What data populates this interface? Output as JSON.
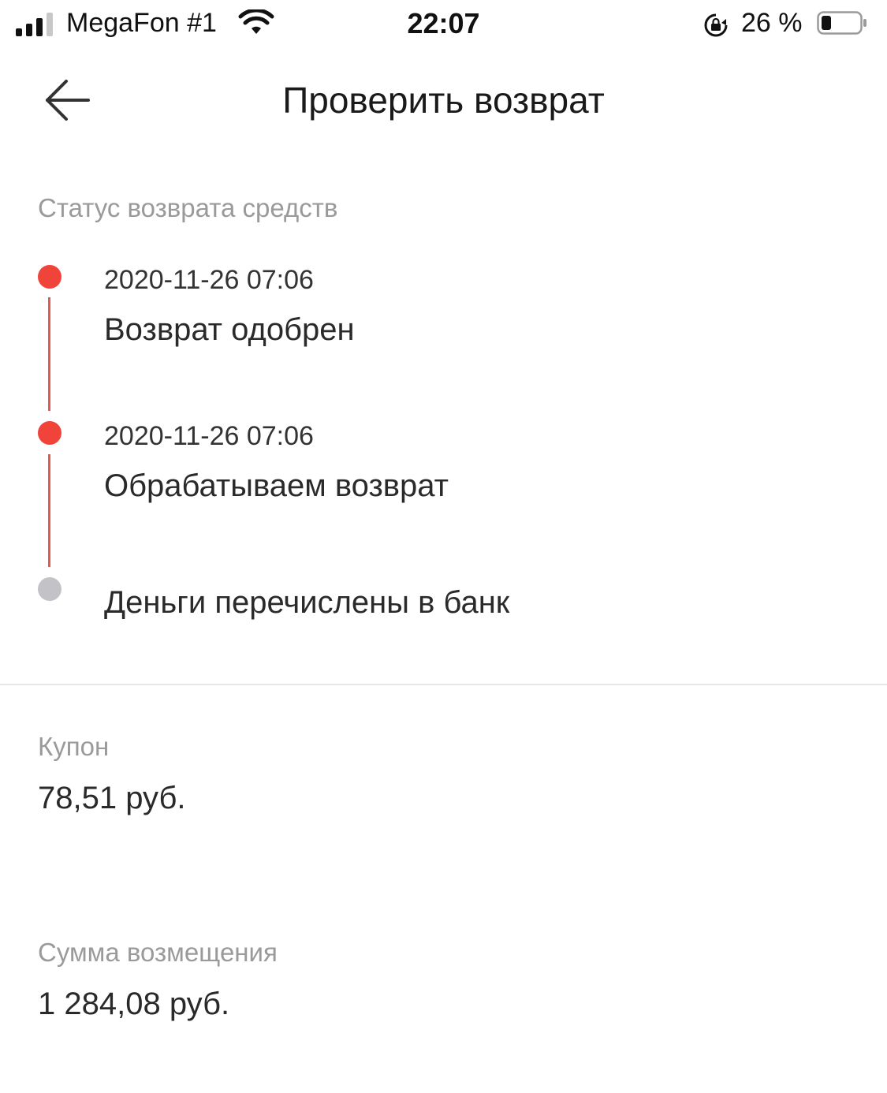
{
  "status_bar": {
    "carrier": "MegaFon #1",
    "time": "22:07",
    "battery_percent": "26 %",
    "battery_level": 0.26,
    "signal_bars_filled": 3,
    "signal_bars_total": 4
  },
  "header": {
    "back_icon": "arrow-left-icon",
    "title": "Проверить возврат"
  },
  "refund_status": {
    "section_label": "Статус возврата средств",
    "steps": [
      {
        "date": "2020-11-26 07:06",
        "label": "Возврат одобрен",
        "state": "done"
      },
      {
        "date": "2020-11-26 07:06",
        "label": "Обрабатываем возврат",
        "state": "done"
      },
      {
        "date": "",
        "label": "Деньги перечислены в банк",
        "state": "pending"
      }
    ]
  },
  "coupon": {
    "label": "Купон",
    "value": "78,51 руб."
  },
  "refund_amount": {
    "label": "Сумма возмещения",
    "value": "1 284,08 руб."
  },
  "colors": {
    "accent_red": "#f0433a",
    "timeline_line": "#e25a52",
    "pending_gray": "#c3c3c7",
    "muted_text": "#9a9a9a"
  }
}
